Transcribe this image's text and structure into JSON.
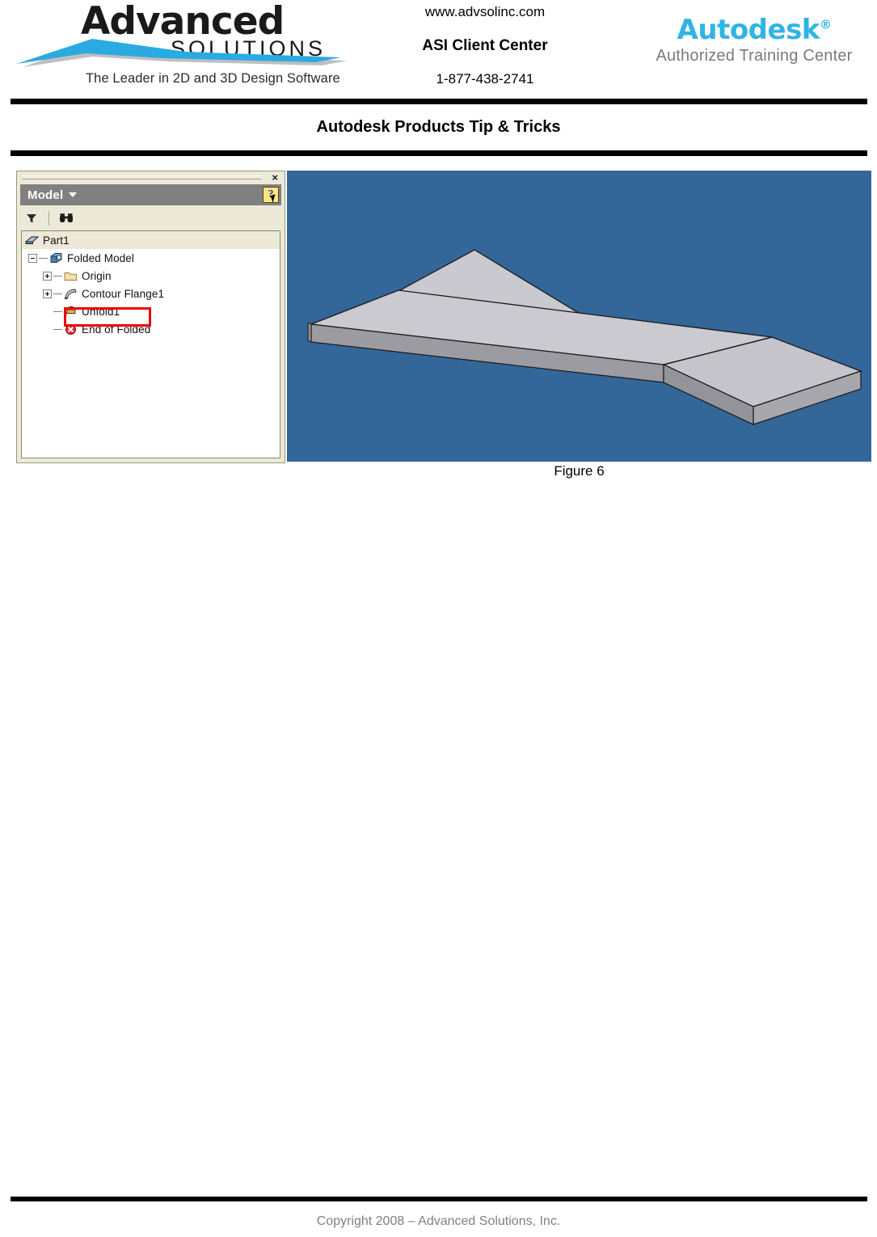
{
  "header": {
    "logo_left": {
      "word": "Advanced",
      "sub": "SOLUTIONS",
      "tagline": "The Leader in 2D and 3D Design Software",
      "swoosh_color": "#29ABE2",
      "swoosh_shadow": "#BFBFBF"
    },
    "center": {
      "url": "www.advsolinc.com",
      "center_name": "ASI Client Center",
      "phone": "1-877-438-2741"
    },
    "logo_right": {
      "word": "Autodesk",
      "trademark": "®",
      "sub": "Authorized Training Center",
      "brand_color": "#30B4E5",
      "sub_color": "#7A7A7A"
    },
    "section_title": "Autodesk Products Tip & Tricks"
  },
  "figure": {
    "caption": "Figure 6",
    "browser": {
      "close_label": "×",
      "title": "Model",
      "help_label": "?",
      "toolbar": [
        {
          "name": "filter-icon",
          "tooltip": "Filter"
        },
        {
          "name": "find-icon",
          "tooltip": "Find"
        }
      ],
      "tree": [
        {
          "label": "Part1",
          "depth": 0,
          "toggle": "none",
          "icon": "sheetmetal-part-icon",
          "selected": true,
          "highlighted": false
        },
        {
          "label": "Folded Model",
          "depth": 1,
          "toggle": "minus",
          "icon": "folded-model-icon",
          "selected": false,
          "highlighted": false
        },
        {
          "label": "Origin",
          "depth": 2,
          "toggle": "plus",
          "icon": "folder-icon",
          "selected": false,
          "highlighted": false
        },
        {
          "label": "Contour Flange1",
          "depth": 2,
          "toggle": "plus",
          "icon": "contour-flange-icon",
          "selected": false,
          "highlighted": false
        },
        {
          "label": "Unfold1",
          "depth": 2,
          "toggle": "line",
          "icon": "unfold-icon",
          "selected": false,
          "highlighted": true
        },
        {
          "label": "End of Folded",
          "depth": 2,
          "toggle": "line",
          "icon": "end-of-part-icon",
          "selected": false,
          "highlighted": false
        }
      ],
      "highlight_color": "#EE0000"
    },
    "viewport": {
      "background_color": "#336699",
      "model_description": "Unfolded sheet metal flat pattern - two coplanar faces split by a bend line",
      "face_top_color": "#C8C8CE",
      "face_right_color": "#C0C0C6",
      "edge_color": "#8A8A90",
      "outline_color": "#1A1A1A"
    }
  },
  "footer": {
    "copyright": "Copyright 2008 – Advanced Solutions, Inc."
  }
}
